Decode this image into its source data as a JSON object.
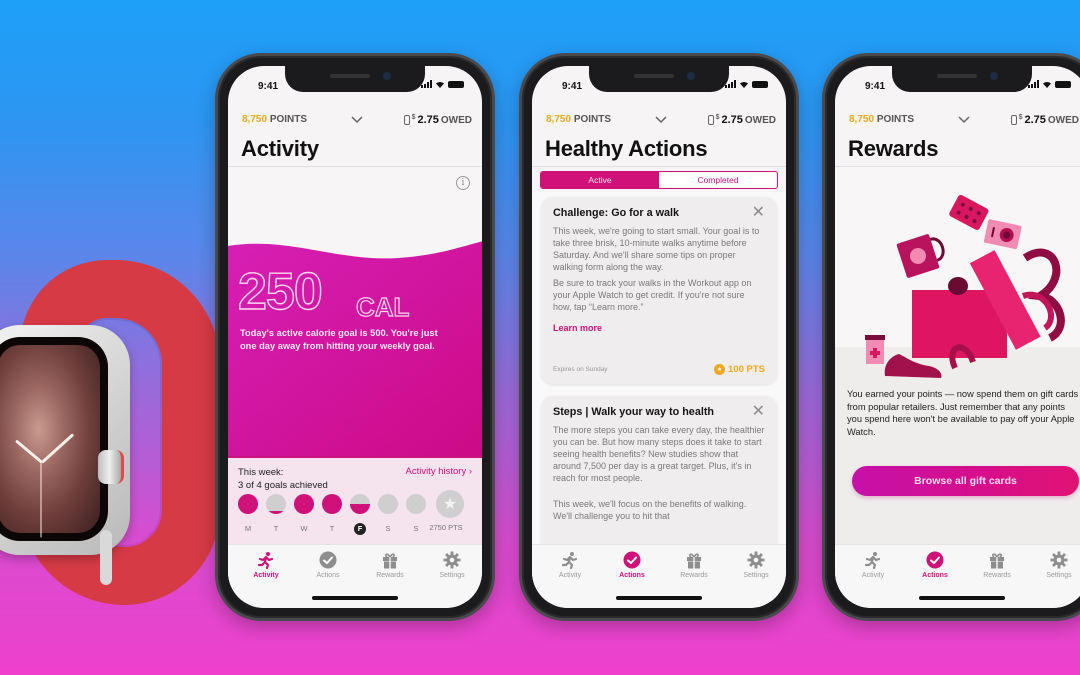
{
  "colors": {
    "brand_magenta": "#d1117a",
    "points_gold": "#f0a81f",
    "background_top": "#1ea0f8",
    "background_bottom": "#ee40cc"
  },
  "common": {
    "time": "9:41",
    "points_value": "8,750",
    "points_label": "POINTS",
    "owed_currency": "$",
    "owed_amount": "2.75",
    "owed_label": "OWED",
    "tabs": [
      {
        "label": "Activity",
        "icon": "running-person-icon"
      },
      {
        "label": "Actions",
        "icon": "check-circle-icon"
      },
      {
        "label": "Rewards",
        "icon": "gift-icon"
      },
      {
        "label": "Settings",
        "icon": "gear-icon"
      }
    ]
  },
  "activity_screen": {
    "title": "Activity",
    "active_tab": "Activity",
    "calories_value": "250",
    "calories_unit": "CAL",
    "description": "Today's active calorie goal is 500. You're just one day away from hitting your weekly goal.",
    "week_label": "This week:",
    "goals_summary": "3 of 4 goals achieved",
    "history_link": "Activity history ›",
    "days": [
      {
        "letter": "M",
        "progress": 1.0,
        "today": false
      },
      {
        "letter": "T",
        "progress": 0.15,
        "today": false
      },
      {
        "letter": "W",
        "progress": 1.0,
        "today": false
      },
      {
        "letter": "T",
        "progress": 1.0,
        "today": false
      },
      {
        "letter": "F",
        "progress": 0.5,
        "today": true
      },
      {
        "letter": "S",
        "progress": 0.0,
        "today": false
      },
      {
        "letter": "S",
        "progress": 0.0,
        "today": false
      }
    ],
    "weekly_reward": "2750 PTS"
  },
  "actions_screen": {
    "title": "Healthy Actions",
    "active_tab": "Actions",
    "segments": [
      "Active",
      "Completed"
    ],
    "selected_segment": "Active",
    "cards": [
      {
        "title": "Challenge: Go for a walk",
        "paragraphs": [
          "This week, we're going to start small. Your goal is to take three brisk, 10-minute walks anytime before Saturday. And we'll share some tips on proper walking form along the way.",
          "Be sure to track your walks in the Workout app on your Apple Watch to get credit. If you're not sure how, tap “Learn more.”"
        ],
        "link": "Learn more",
        "expires": "Expires on Sunday",
        "points": "100 PTS"
      },
      {
        "title": "Steps | Walk your way to health",
        "paragraphs": [
          "The more steps you can take every day, the healthier you can be. But how many steps does it take to start seeing health benefits? New studies show that around 7,500 per day is a great target. Plus, it's in reach for most people.",
          "This week, we'll focus on the benefits of walking. We'll challenge you to hit that"
        ]
      }
    ]
  },
  "rewards_screen": {
    "title": "Rewards",
    "active_tab": "Actions",
    "description": "You earned your points — now spend them on gift cards from popular retailers. Just remember that any points you spend here won't be available to pay off your Apple Watch.",
    "button_label": "Browse all gift cards"
  }
}
